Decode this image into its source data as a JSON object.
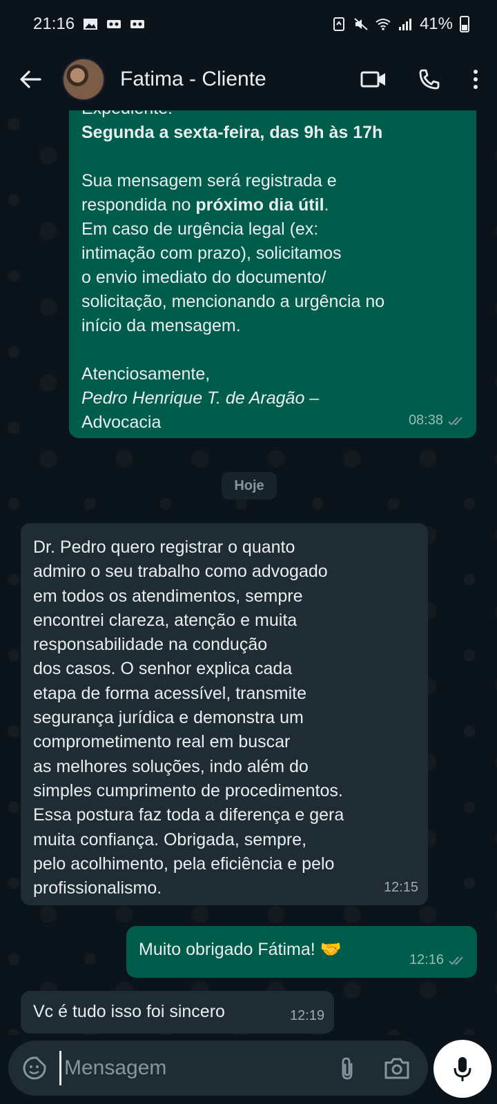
{
  "status_bar": {
    "time": "21:16",
    "battery": "41%",
    "icons": [
      "gallery-icon",
      "voicemail-icon",
      "voicemail-icon",
      "recycle-icon",
      "mute-icon",
      "wifi-icon",
      "signal-icon",
      "battery-icon"
    ]
  },
  "header": {
    "contact_name": "Fatima - Cliente",
    "icons": [
      "back-arrow-icon",
      "video-call-icon",
      "voice-call-icon",
      "more-options-icon"
    ]
  },
  "messages": [
    {
      "direction": "outgoing",
      "lines": [
        {
          "text": "Expediente:"
        },
        {
          "text": "Segunda a sexta-feira, das 9h às 17h"
        },
        {
          "text": ""
        },
        {
          "text": "Sua mensagem será registrada e"
        },
        {
          "text_a": "respondida no ",
          "text_bold": "próximo dia útil",
          "text_b": "."
        },
        {
          "text": "Em caso de urgência legal (ex:"
        },
        {
          "text": "intimação com prazo), solicitamos"
        },
        {
          "text": "o envio imediato do documento/"
        },
        {
          "text": "solicitação, mencionando a urgência no"
        },
        {
          "text": "início da mensagem."
        },
        {
          "text": ""
        },
        {
          "text": "Atenciosamente,"
        },
        {
          "text": "Pedro Henrique T. de Aragão –"
        },
        {
          "text": "Advocacia"
        }
      ],
      "time": "08:38",
      "status": "read"
    },
    {
      "direction": "incoming",
      "text": "Dr. Pedro quero registrar o quanto\nadmiro o seu trabalho como advogado\nem todos os atendimentos, sempre\nencontrei clareza, atenção e muita\nresponsabilidade na condução\ndos casos. O senhor explica cada\netapa de forma acessível, transmite\nsegurança jurídica e demonstra um\ncomprometimento real em buscar\nas melhores soluções, indo além do\nsimples cumprimento de procedimentos.\nEssa postura faz toda a diferença e gera\nmuita confiança. Obrigada, sempre,\npelo acolhimento, pela eficiência e pelo\nprofissionalismo.",
      "time": "12:15"
    },
    {
      "direction": "outgoing",
      "text": "Muito obrigado Fátima! 🤝",
      "time": "12:16",
      "status": "read"
    },
    {
      "direction": "incoming",
      "text": "Vc é tudo isso foi sincero",
      "time": "12:19"
    }
  ],
  "date_divider": "Hoje",
  "composer": {
    "placeholder": "Mensagem",
    "icons": [
      "sticker-icon",
      "attach-icon",
      "camera-icon",
      "microphone-icon"
    ]
  },
  "colors": {
    "background": "#0b141a",
    "outgoing_bubble": "#005c4b",
    "incoming_bubble": "#202c33",
    "read_tick": "#8696a0"
  }
}
